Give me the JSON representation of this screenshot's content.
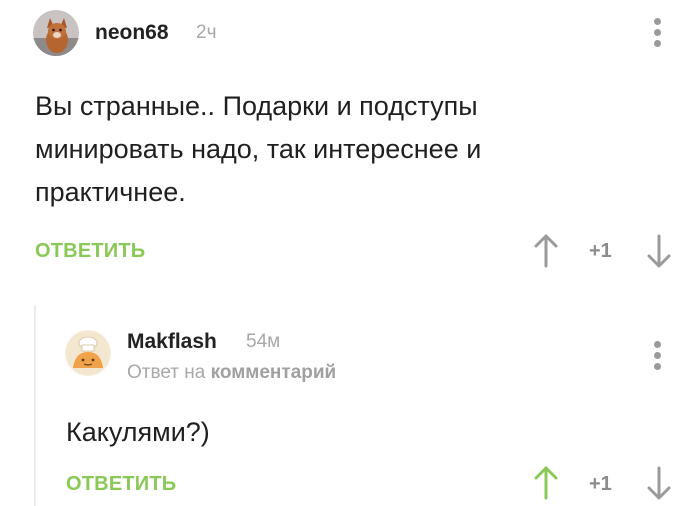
{
  "comments": [
    {
      "username": "neon68",
      "time": "2ч",
      "text": "Вы странные.. Подарки и подступы минировать надо, так интереснее и практичнее.",
      "reply_label": "ОТВЕТИТЬ",
      "rating": "+1",
      "vote_up_color": "#9a9a9a",
      "avatar": "fox-avatar"
    },
    {
      "username": "Makflash",
      "time": "54м",
      "reply_to_prefix": "Ответ на",
      "reply_to_target": "комментарий",
      "text": "Какулями?)",
      "reply_label": "ОТВЕТИТЬ",
      "rating": "+1",
      "vote_up_color": "#8ac858",
      "avatar": "chef-avatar"
    }
  ],
  "colors": {
    "accent_green": "#8ac858",
    "muted_gray": "#a8a8a8",
    "icon_gray": "#9a9a9a"
  }
}
